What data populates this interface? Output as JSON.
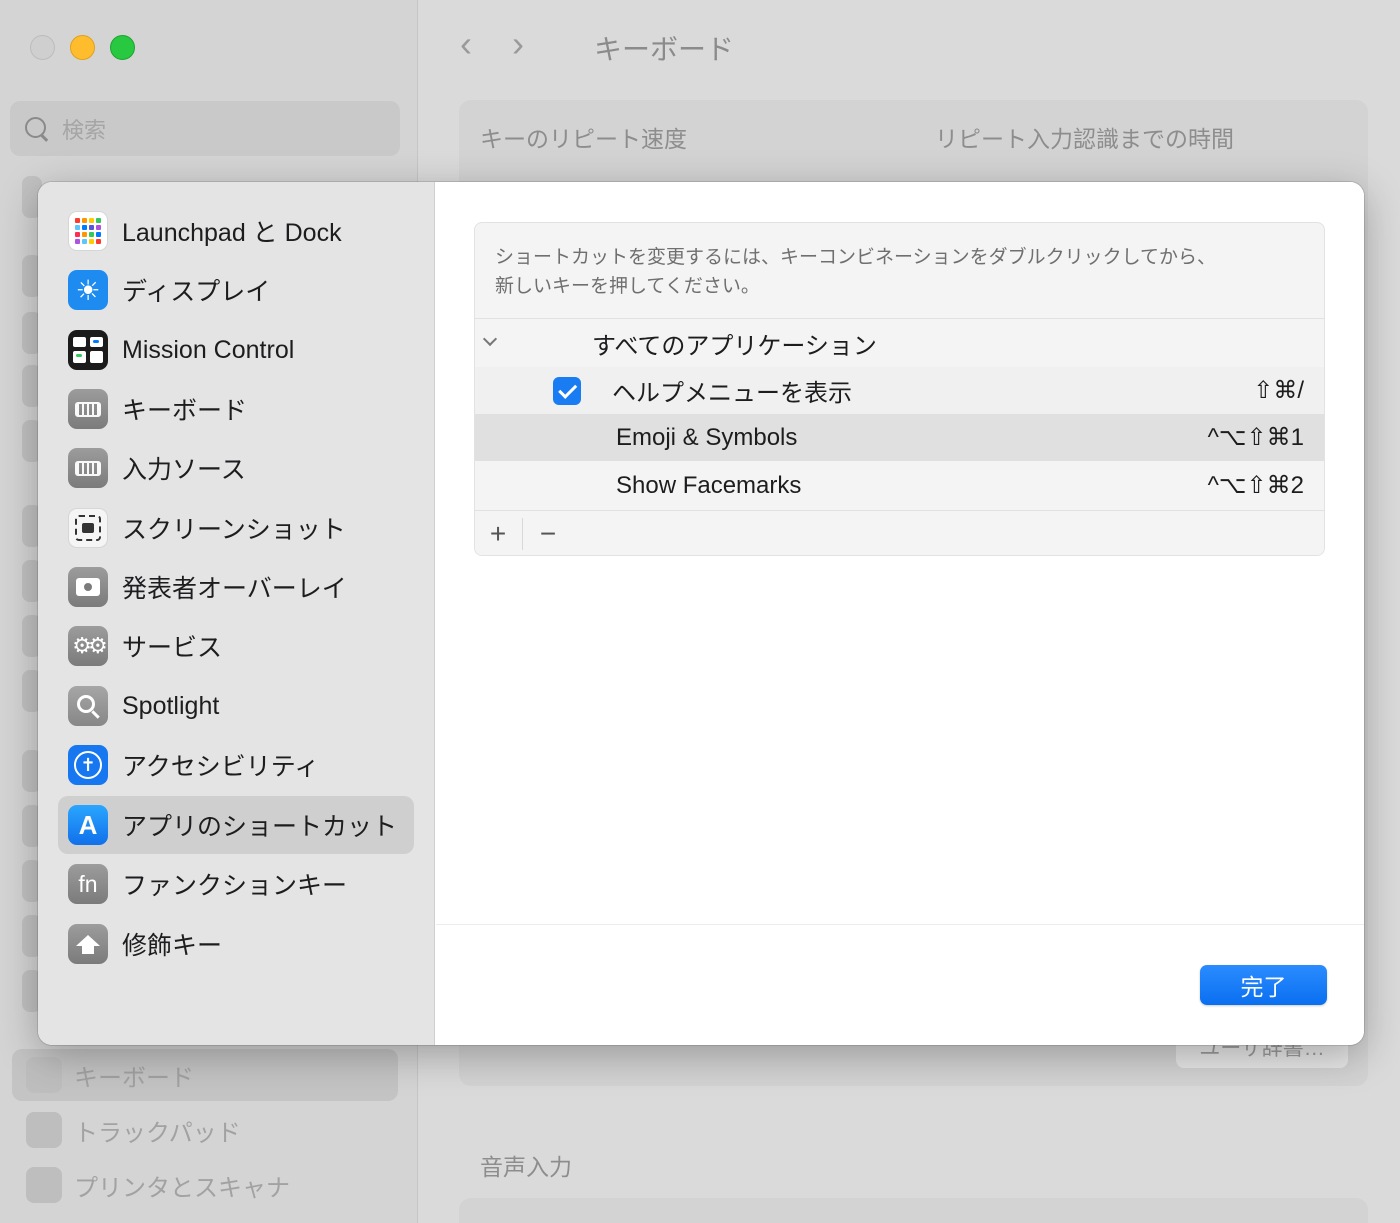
{
  "window": {
    "title": "キーボード",
    "search_placeholder": "検索",
    "sections": {
      "repeat_speed": "キーのリピート速度",
      "repeat_delay": "リピート入力認識までの時間",
      "dictionary_button": "ユーザ辞書…",
      "voice_input": "音声入力"
    },
    "sidebar_items": [
      {
        "label": "キーボード",
        "icon": "keyboard-icon"
      },
      {
        "label": "トラックパッド",
        "icon": "trackpad-icon"
      },
      {
        "label": "プリンタとスキャナ",
        "icon": "printer-icon"
      }
    ]
  },
  "sheet": {
    "sidebar": [
      {
        "label": "Launchpad と Dock",
        "icon": "launchpad-icon"
      },
      {
        "label": "ディスプレイ",
        "icon": "display-icon"
      },
      {
        "label": "Mission Control",
        "icon": "mission-control-icon"
      },
      {
        "label": "キーボード",
        "icon": "keyboard-icon"
      },
      {
        "label": "入力ソース",
        "icon": "input-sources-icon"
      },
      {
        "label": "スクリーンショット",
        "icon": "screenshot-icon"
      },
      {
        "label": "発表者オーバーレイ",
        "icon": "presenter-overlay-icon"
      },
      {
        "label": "サービス",
        "icon": "services-gears-icon"
      },
      {
        "label": "Spotlight",
        "icon": "spotlight-icon"
      },
      {
        "label": "アクセシビリティ",
        "icon": "accessibility-icon"
      },
      {
        "label": "アプリのショートカット",
        "icon": "app-shortcuts-icon",
        "selected": true
      },
      {
        "label": "ファンクションキー",
        "icon": "fn-key-icon"
      },
      {
        "label": "修飾キー",
        "icon": "modifier-keys-icon"
      }
    ],
    "hint": "ショートカットを変更するには、キーコンビネーションをダブルクリックしてから、\n新しいキーを押してください。",
    "group_label": "すべてのアプリケーション",
    "shortcuts": [
      {
        "label": "ヘルプメニューを表示",
        "keys": "⇧⌘/",
        "checked": true
      },
      {
        "label": "Emoji & Symbols",
        "keys": "^⌥⇧⌘1"
      },
      {
        "label": "Show Facemarks",
        "keys": "^⌥⇧⌘2"
      }
    ],
    "add_label": "+",
    "remove_label": "−",
    "done_label": "完了"
  },
  "colors": {
    "accent": "#1a7cf2",
    "traffic_yellow": "#ffbd2e",
    "traffic_green": "#28c840"
  }
}
